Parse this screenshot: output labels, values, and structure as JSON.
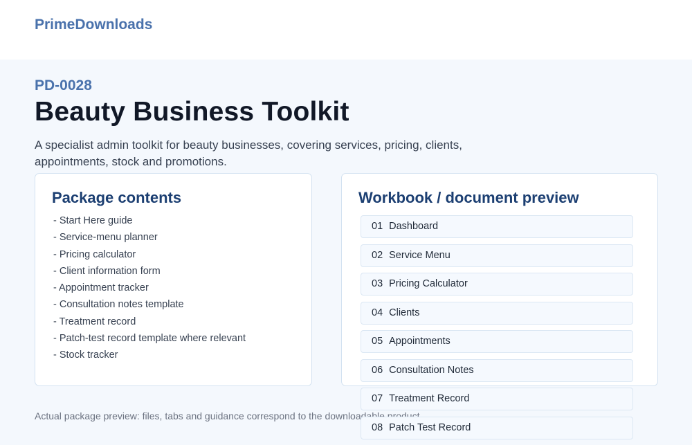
{
  "header": {
    "brand": "PrimeDownloads"
  },
  "product": {
    "code": "PD-0028",
    "title": "Beauty Business Toolkit",
    "description": "A specialist admin toolkit for beauty businesses, covering services, pricing, clients, appointments, stock and promotions."
  },
  "package_contents": {
    "heading": "Package contents",
    "items": [
      "- Start Here guide",
      "- Service-menu planner",
      "- Pricing calculator",
      "- Client information form",
      "- Appointment tracker",
      "- Consultation notes template",
      "- Treatment record",
      "- Patch-test record template where relevant",
      "- Stock tracker"
    ]
  },
  "preview": {
    "heading": "Workbook / document preview",
    "tabs": [
      {
        "num": "01",
        "label": "Dashboard"
      },
      {
        "num": "02",
        "label": "Service Menu"
      },
      {
        "num": "03",
        "label": "Pricing Calculator"
      },
      {
        "num": "04",
        "label": "Clients"
      },
      {
        "num": "05",
        "label": "Appointments"
      },
      {
        "num": "06",
        "label": "Consultation Notes"
      },
      {
        "num": "07",
        "label": "Treatment Record"
      },
      {
        "num": "08",
        "label": "Patch Test Record"
      }
    ]
  },
  "footnote": "Actual package preview: files, tabs and guidance correspond to the downloadable product.",
  "colors": {
    "brand": "#4a72ac",
    "heading": "#1c3f72",
    "page_background": "#f4f8fd",
    "card_border": "#d3e2f1"
  }
}
